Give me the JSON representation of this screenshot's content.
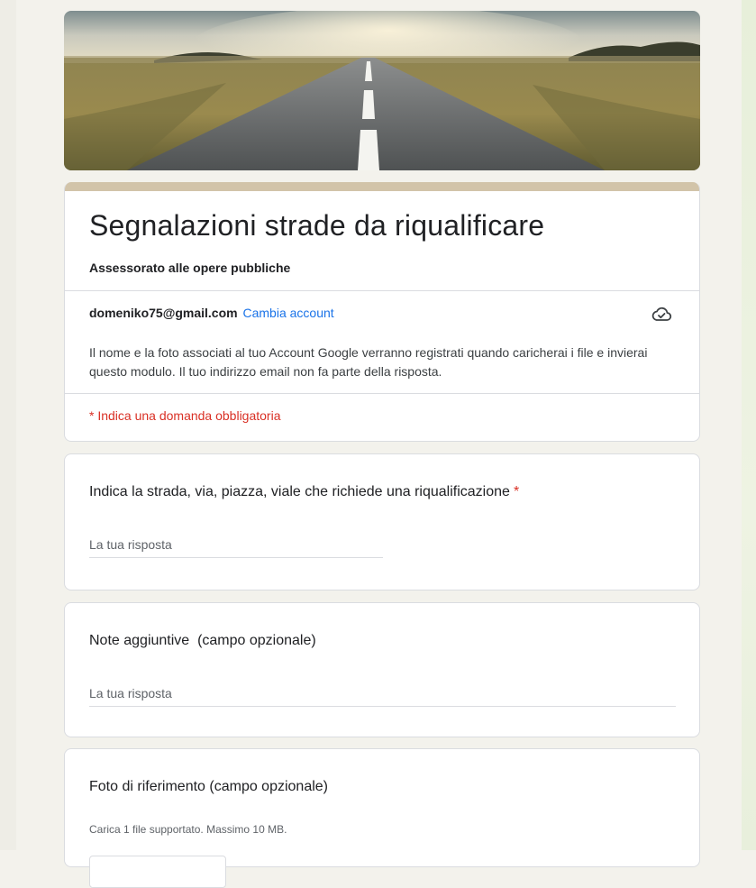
{
  "form": {
    "title": "Segnalazioni strade da riqualificare",
    "description": "Assessorato alle opere pubbliche",
    "accent_color": "#d2c4a9"
  },
  "account": {
    "email": "domeniko75@gmail.com",
    "switch_label": "Cambia account",
    "status_icon": "cloud-check-icon",
    "privacy_note": "Il nome e la foto associati al tuo Account Google verranno registrati quando caricherai i file e invierai questo modulo. Il tuo indirizzo email non fa parte della risposta."
  },
  "required_note": "* Indica una domanda obbligatoria",
  "questions": [
    {
      "label": "Indica la strada, via, piazza, viale che richiede una riqualificazione",
      "required_mark": "*",
      "placeholder": "La tua risposta"
    },
    {
      "label": "Note aggiuntive  (campo opzionale)",
      "placeholder": "La tua risposta"
    },
    {
      "label": "Foto di riferimento (campo opzionale)",
      "hint": "Carica 1 file supportato. Massimo 10 MB."
    }
  ]
}
